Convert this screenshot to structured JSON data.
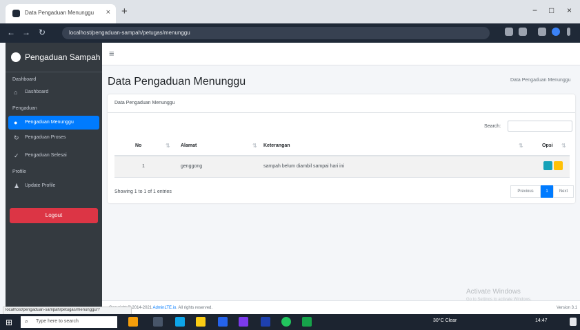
{
  "browser": {
    "tab_title": "Data Pengaduan Menunggu",
    "tab_close": "×",
    "new_tab": "+",
    "url": "localhost/pengaduan-sampah/petugas/menunggu",
    "back": "←",
    "forward": "→",
    "reload": "↻",
    "minimize": "−",
    "maximize": "□",
    "close": "×"
  },
  "sidebar": {
    "brand": "Pengaduan Sampah",
    "sections": {
      "dashboard": "Dashboard",
      "pengaduan": "Pengaduan",
      "profile": "Profile"
    },
    "items": [
      {
        "label": "Dashboard",
        "icon": "home-icon"
      },
      {
        "label": "Pengaduan Menunggu",
        "icon": "exclamation-circle-icon"
      },
      {
        "label": "Pengaduan Proses",
        "icon": "sync-icon"
      },
      {
        "label": "Pengaduan Selesai",
        "icon": "check-icon"
      },
      {
        "label": "Update Profile",
        "icon": "user-edit-icon"
      }
    ],
    "logout": "Logout"
  },
  "navbar": {
    "menu_icon": "≡"
  },
  "page": {
    "title": "Data Pengaduan Menunggu",
    "breadcrumb": "Data Pengaduan Menunggu"
  },
  "card": {
    "header": "Data Pengaduan Menunggu",
    "search_label": "Search:",
    "table": {
      "columns": [
        "No",
        "Alamat",
        "Keterangan",
        "Opsi"
      ],
      "rows": [
        {
          "no": "1",
          "alamat": "genggong",
          "keterangan": "sampah belum diambil sampai hari ini"
        }
      ]
    },
    "info": "Showing 1 to 1 of 1 entries",
    "pagination": {
      "previous": "Previous",
      "current": "1",
      "next": "Next"
    }
  },
  "watermark": {
    "title": "Activate Windows",
    "subtitle": "Go to Settings to activate Windows."
  },
  "footer": {
    "copyright_prefix": "Copyright © 2014-2021 ",
    "copyright_link": "AdminLTE.io",
    "copyright_suffix": ". All rights reserved.",
    "version": "Version 3.1"
  },
  "status_url": "localhost/pengaduan-sampah/petugas/menunggu/?",
  "taskbar": {
    "search_placeholder": "Type here to search",
    "weather": "30°C Clear",
    "time": "14:47"
  },
  "colors": {
    "sidebar": "#343a40",
    "accent": "#007bff",
    "logout": "#dc3545",
    "detail_button": "#17a2b8",
    "edit_button": "#ffc107"
  }
}
